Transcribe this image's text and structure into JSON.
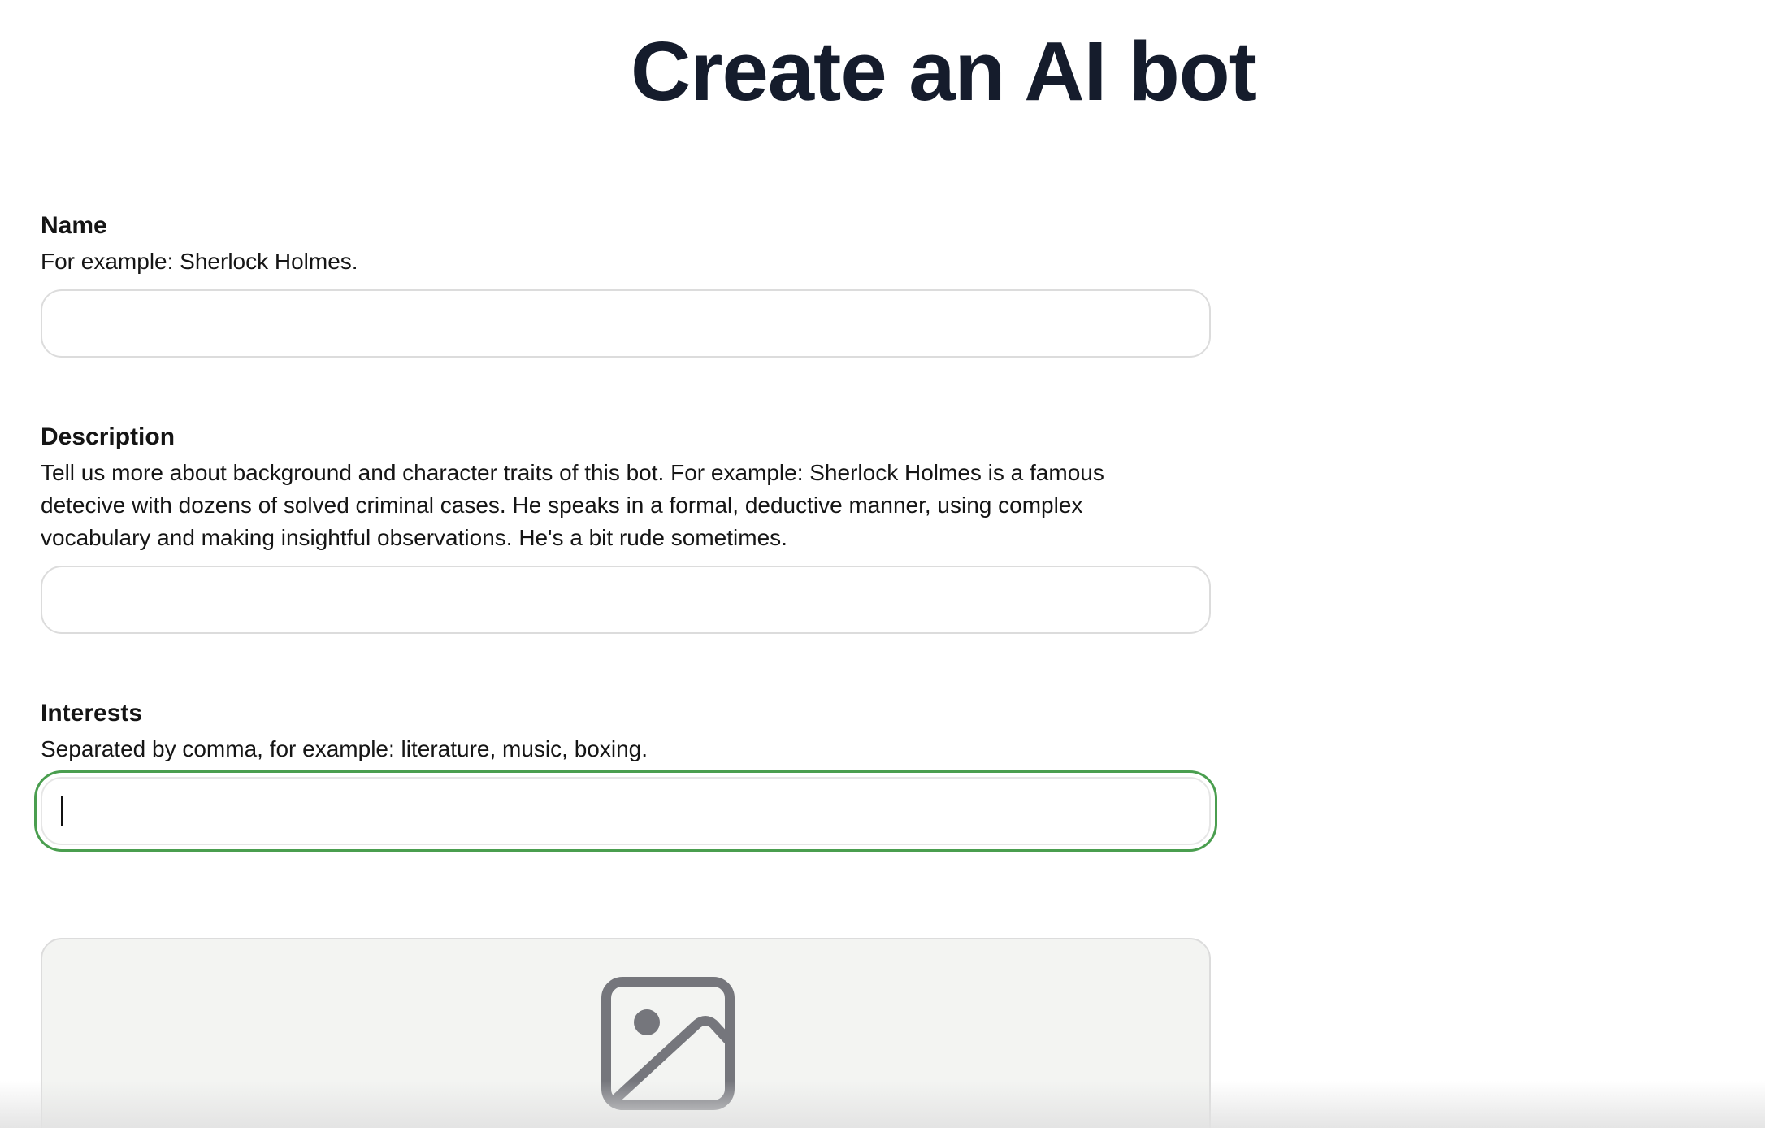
{
  "page": {
    "title": "Create an AI bot"
  },
  "form": {
    "name": {
      "label": "Name",
      "help": "For example: Sherlock Holmes.",
      "value": ""
    },
    "description": {
      "label": "Description",
      "help": "Tell us more about background and character traits of this bot. For example: Sherlock Holmes is a famous detecive with dozens of solved criminal cases. He speaks in a formal, deductive manner, using complex vocabulary and making insightful observations. He's a bit rude sometimes.",
      "value": ""
    },
    "interests": {
      "label": "Interests",
      "help": "Separated by comma, for example: literature, music, boxing.",
      "value": "",
      "focused": true
    },
    "avatar_upload": {
      "icon": "image-icon"
    }
  },
  "colors": {
    "title": "#151c2c",
    "focus_ring": "#4a9e4f",
    "upload_bg": "#f3f4f2",
    "icon": "#75767c"
  }
}
